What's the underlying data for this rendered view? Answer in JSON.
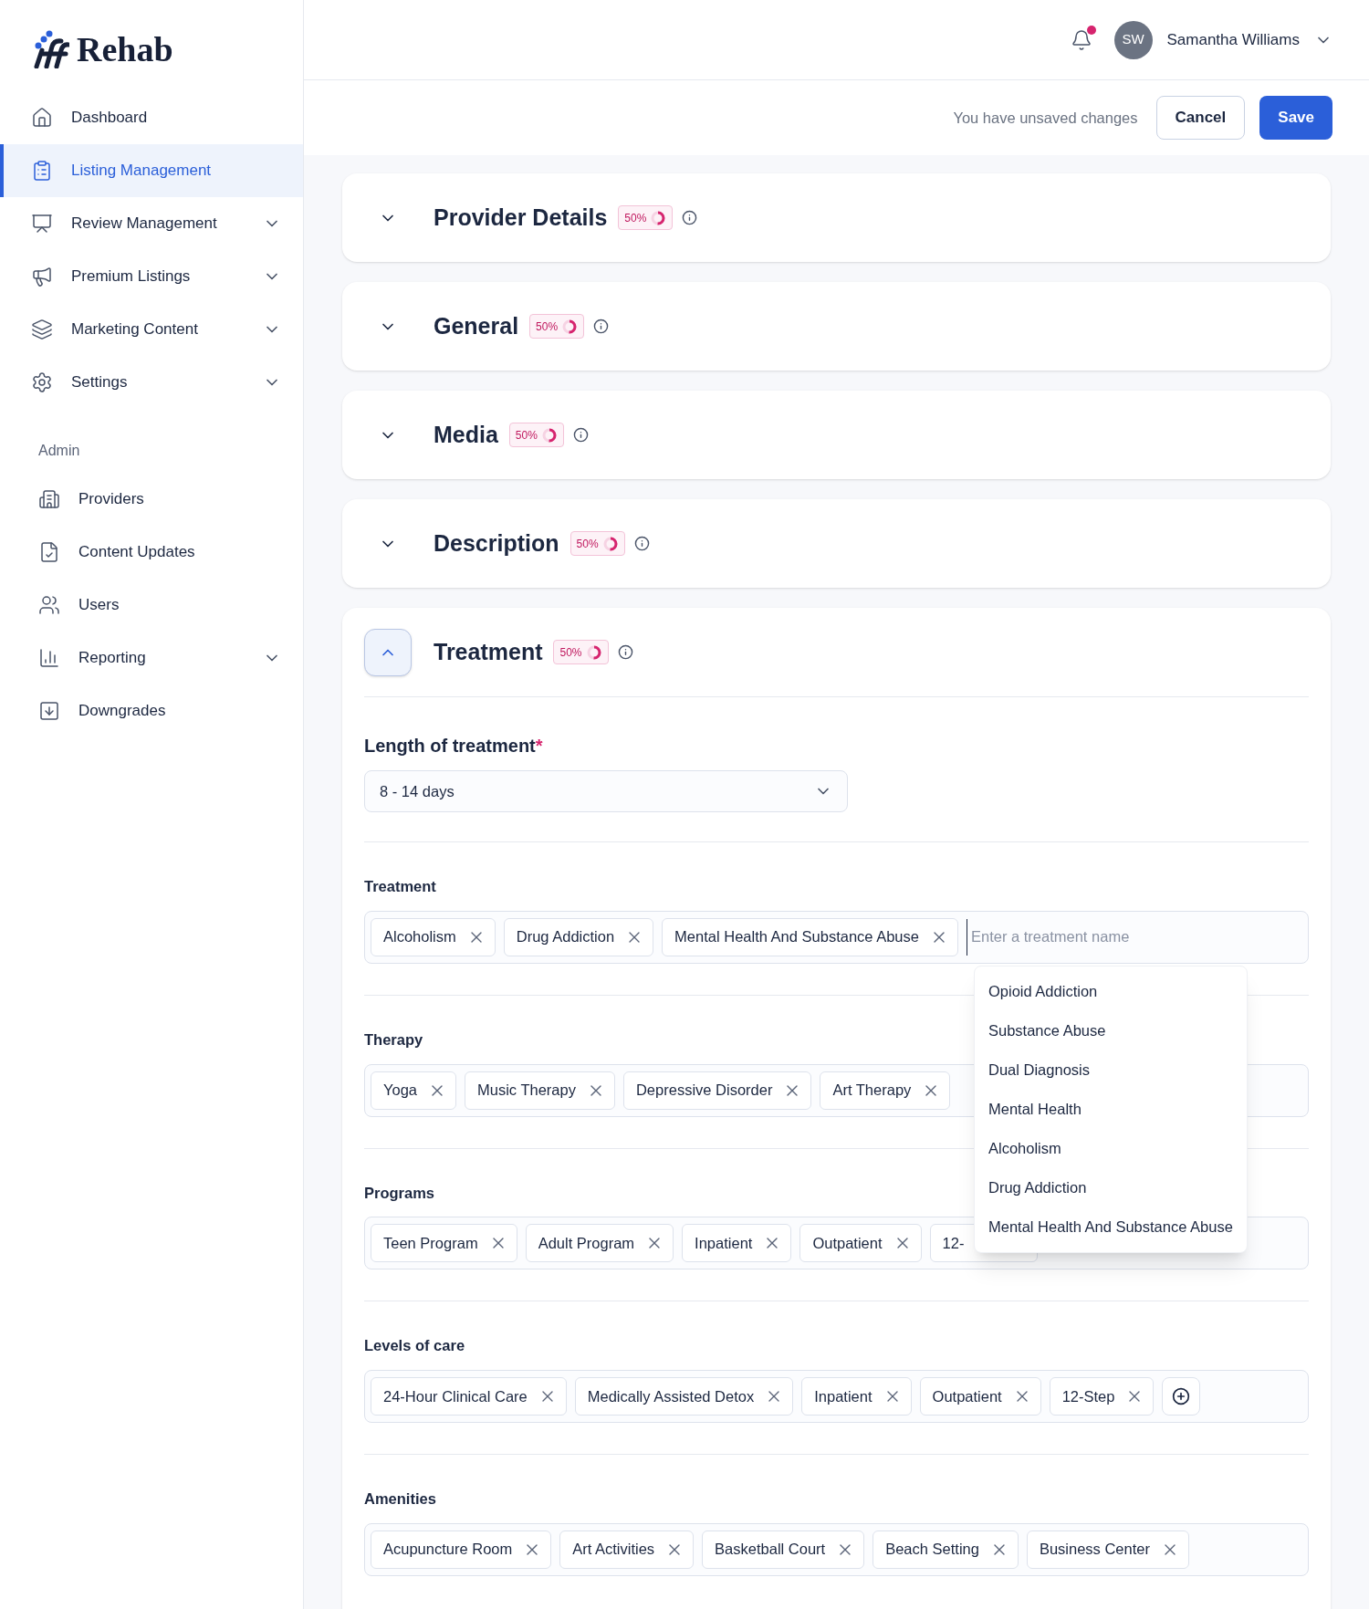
{
  "brand": {
    "name": "Rehab"
  },
  "sidebar": {
    "items": [
      {
        "label": "Dashboard",
        "selected": false,
        "expandable": false
      },
      {
        "label": "Listing Management",
        "selected": true,
        "expandable": false
      },
      {
        "label": "Review Management",
        "selected": false,
        "expandable": true
      },
      {
        "label": "Premium Listings",
        "selected": false,
        "expandable": true
      },
      {
        "label": "Marketing Content",
        "selected": false,
        "expandable": true
      },
      {
        "label": "Settings",
        "selected": false,
        "expandable": true
      }
    ],
    "admin_heading": "Admin",
    "admin_items": [
      {
        "label": "Providers",
        "selected": false,
        "expandable": false
      },
      {
        "label": "Content Updates",
        "selected": false,
        "expandable": false
      },
      {
        "label": "Users",
        "selected": false,
        "expandable": false
      },
      {
        "label": "Reporting",
        "selected": false,
        "expandable": true
      },
      {
        "label": "Downgrades",
        "selected": false,
        "expandable": false
      }
    ]
  },
  "header": {
    "notifications_unread": true,
    "user": {
      "initials": "SW",
      "name": "Samantha Williams"
    }
  },
  "toolbar": {
    "message": "You have unsaved changes",
    "buttons": [
      {
        "label": "Cancel",
        "kind": "secondary"
      },
      {
        "label": "Save",
        "kind": "primary"
      }
    ]
  },
  "sections": [
    {
      "title": "Provider Details",
      "expanded": false,
      "progress": {
        "text": "50%",
        "level": 0.5
      }
    },
    {
      "title": "General",
      "expanded": false,
      "progress": {
        "text": "50%",
        "level": 0.5
      }
    },
    {
      "title": "Media",
      "expanded": false,
      "progress": {
        "text": "50%",
        "level": 0.5
      }
    },
    {
      "title": "Description",
      "expanded": false,
      "progress": {
        "text": "50%",
        "level": 0.5
      }
    },
    {
      "title": "Treatment",
      "expanded": true,
      "progress": {
        "text": "50%",
        "level": 0.5
      }
    }
  ],
  "treatment_form": {
    "length": {
      "label": "Length of treatment",
      "required_mark": "*",
      "value": "8 - 14 days"
    },
    "tag_groups": [
      {
        "label": "Treatment",
        "tags": [
          "Alcoholism",
          "Drug Addiction",
          "Mental Health And Substance Abuse"
        ],
        "placeholder": "Enter a treatment name"
      },
      {
        "label": "Therapy",
        "tags": [
          "Yoga",
          "Music Therapy",
          "Depressive Disorder",
          "Art Therapy"
        ]
      },
      {
        "label": "Programs",
        "tags": [
          "Teen Program",
          "Adult Program",
          "Inpatient",
          "Outpatient",
          "12-"
        ],
        "last_tag_cut": true
      },
      {
        "label": "Levels of care",
        "tags": [
          "24-Hour Clinical Care",
          "Medically Assisted Detox",
          "Inpatient",
          "Outpatient",
          "12-Step"
        ],
        "add_button": true
      },
      {
        "label": "Amenities",
        "tags": [
          "Acupuncture Room",
          "Art Activities",
          "Basketball Court",
          "Beach Setting",
          "Business Center"
        ]
      }
    ],
    "suggestions": [
      "Opioid Addiction",
      "Substance Abuse",
      "Dual Diagnosis",
      "Mental Health",
      "Alcoholism",
      "Drug Addiction",
      "Mental Health And Substance Abuse"
    ]
  }
}
